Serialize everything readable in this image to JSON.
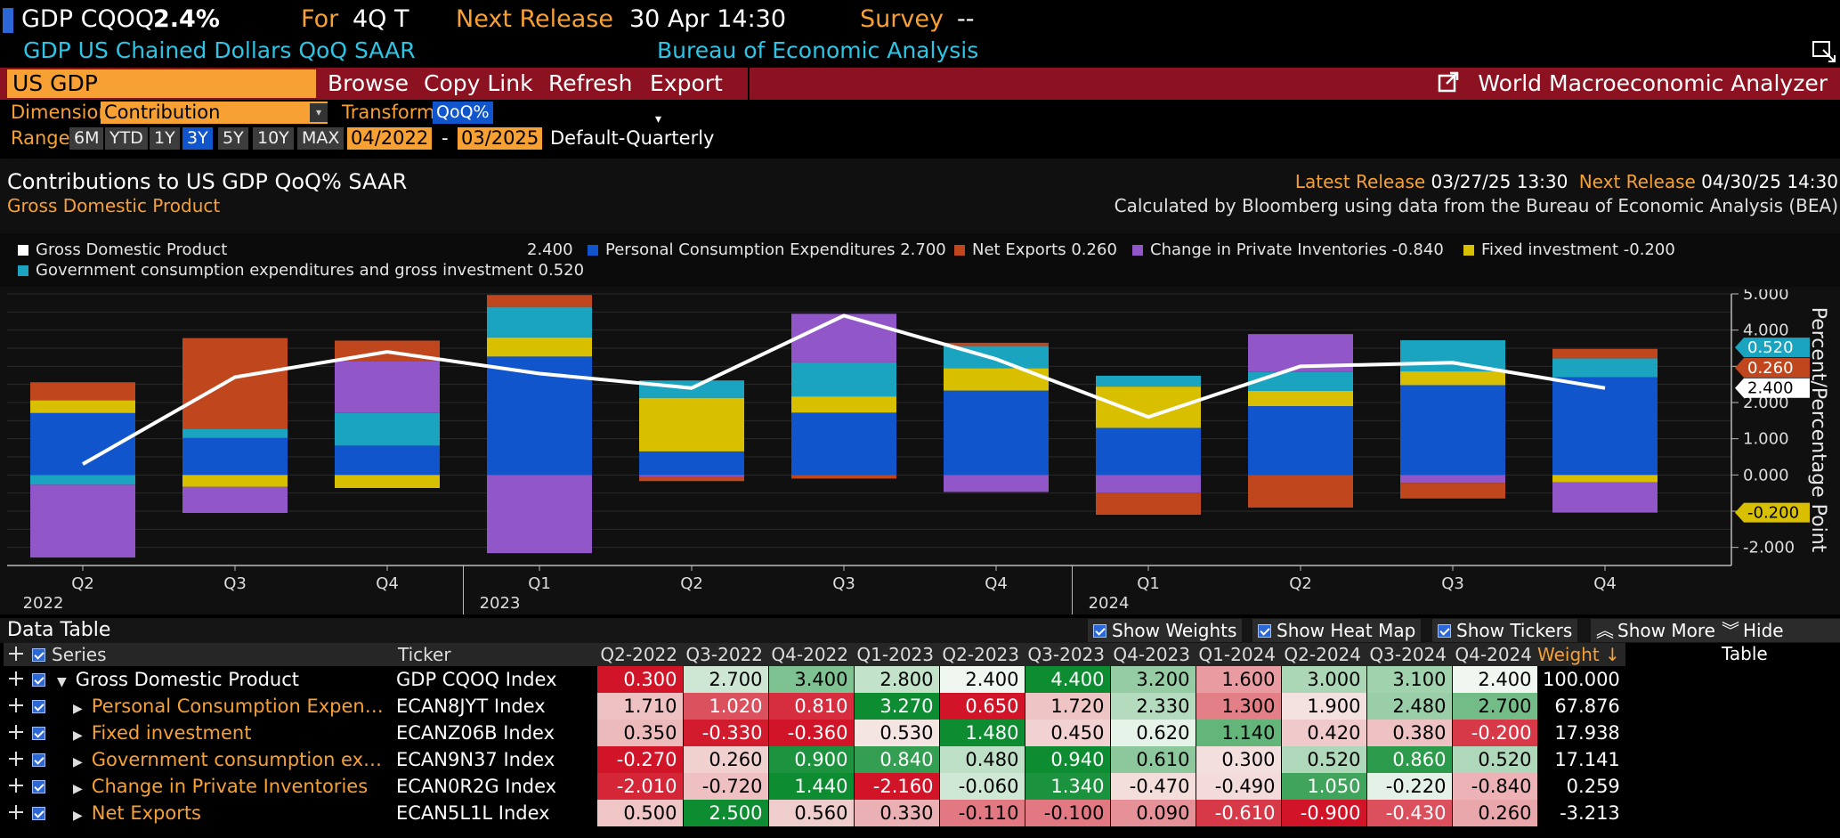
{
  "header": {
    "ticker": "GDP CQOQ",
    "value": "2.4%",
    "for_label": "For",
    "for_value": "4Q T",
    "next_release_label": "Next Release",
    "next_release_value": "30 Apr 14:30",
    "survey_label": "Survey",
    "survey_value": "--",
    "description": "GDP US Chained Dollars QoQ SAAR",
    "source": "Bureau of Economic Analysis"
  },
  "toolbar": {
    "security": "US GDP",
    "browse": "Browse",
    "copy_link": "Copy Link",
    "refresh": "Refresh",
    "export": "Export",
    "app_name": "World Macroeconomic Analyzer"
  },
  "controls": {
    "dimension_label": "Dimension",
    "dimension_value": "Contribution",
    "transform_label": "Transform",
    "transform_value": "QoQ%",
    "range_label": "Range",
    "range_buttons": [
      "6M",
      "YTD",
      "1Y",
      "3Y",
      "5Y",
      "10Y",
      "MAX"
    ],
    "range_selected": "3Y",
    "start_date": "04/2022",
    "range_sep": "-",
    "end_date": "03/2025",
    "frequency": "Default-Quarterly"
  },
  "chart_info": {
    "title": "Contributions to US GDP QoQ% SAAR",
    "subtitle": "Gross Domestic Product",
    "latest_release_label": "Latest Release",
    "latest_release_value": "03/27/25 13:30",
    "next_release_label": "Next Release",
    "next_release_value": "04/30/25 14:30",
    "calc_note": "Calculated by Bloomberg using data from the Bureau of Economic Analysis (BEA)"
  },
  "legend": [
    {
      "label": "Gross Domestic Product",
      "value": "2.400",
      "color": "#ffffff"
    },
    {
      "label": "Personal Consumption Expenditures",
      "value": "2.700",
      "color": "#1155cc"
    },
    {
      "label": "Net Exports",
      "value": "0.260",
      "color": "#c0461e"
    },
    {
      "label": "Change in Private Inventories",
      "value": "-0.840",
      "color": "#9157c9"
    },
    {
      "label": "Fixed investment",
      "value": "-0.200",
      "color": "#d8c000"
    },
    {
      "label": "Government consumption expenditures and gross investment",
      "value": "0.520",
      "color": "#1aa4c0"
    }
  ],
  "chart_data": {
    "type": "bar",
    "stacked": true,
    "categories": [
      "Q2",
      "Q3",
      "Q4",
      "Q1",
      "Q2",
      "Q3",
      "Q4",
      "Q1",
      "Q2",
      "Q3",
      "Q4"
    ],
    "year_labels": [
      "2022",
      "2023",
      "2024"
    ],
    "ylim": [
      -2.5,
      5.0
    ],
    "yticks": [
      "5.000",
      "4.000",
      "3.000",
      "2.000",
      "1.000",
      "0.000",
      "-1.000",
      "-2.000"
    ],
    "ylabel": "Percent/Percentage Point",
    "grid": true,
    "series": [
      {
        "name": "Personal Consumption Expenditures",
        "color": "#1155cc",
        "values": [
          1.71,
          1.02,
          0.81,
          3.27,
          0.65,
          1.72,
          2.33,
          1.3,
          1.9,
          2.48,
          2.7
        ]
      },
      {
        "name": "Fixed investment",
        "color": "#d8c000",
        "values": [
          0.35,
          -0.33,
          -0.36,
          0.53,
          1.48,
          0.45,
          0.62,
          1.14,
          0.42,
          0.38,
          -0.2
        ]
      },
      {
        "name": "Government consumption expenditures and gross investment",
        "color": "#1aa4c0",
        "values": [
          -0.27,
          0.26,
          0.9,
          0.84,
          0.48,
          0.94,
          0.61,
          0.3,
          0.52,
          0.86,
          0.52
        ]
      },
      {
        "name": "Change in Private Inventories",
        "color": "#9157c9",
        "values": [
          -2.01,
          -0.72,
          1.44,
          -2.16,
          -0.06,
          1.34,
          -0.47,
          -0.49,
          1.05,
          -0.22,
          -0.84
        ]
      },
      {
        "name": "Net Exports",
        "color": "#c0461e",
        "values": [
          0.5,
          2.5,
          0.56,
          0.33,
          -0.11,
          -0.1,
          0.09,
          -0.61,
          -0.9,
          -0.43,
          0.26
        ]
      }
    ],
    "line": {
      "name": "Gross Domestic Product",
      "color": "#ffffff",
      "values": [
        0.3,
        2.7,
        3.4,
        2.8,
        2.4,
        4.4,
        3.2,
        1.6,
        3.0,
        3.1,
        2.4
      ]
    },
    "right_labels": [
      {
        "text": "0.520",
        "color": "#1aa4c0",
        "value": 3.52
      },
      {
        "text": "0.260",
        "color": "#c0461e",
        "value": 2.96
      },
      {
        "text": "2.400",
        "color": "#ffffff",
        "value": 2.4
      },
      {
        "text": "-0.200",
        "color": "#d8c000",
        "value": -1.04
      }
    ]
  },
  "data_table": {
    "title": "Data Table",
    "options": [
      "Show Weights",
      "Show Heat Map",
      "Show Tickers"
    ],
    "show_more": "Show More",
    "hide_table": "Hide Table",
    "columns": {
      "series": "Series",
      "ticker": "Ticker",
      "periods": [
        "Q2-2022",
        "Q3-2022",
        "Q4-2022",
        "Q1-2023",
        "Q2-2023",
        "Q3-2023",
        "Q4-2023",
        "Q1-2024",
        "Q2-2024",
        "Q3-2024",
        "Q4-2024"
      ],
      "weight": "Weight ↓"
    },
    "rows": [
      {
        "series": "Gross Domestic Product",
        "ticker": "GDP CQOQ Index",
        "values": [
          "0.300",
          "2.700",
          "3.400",
          "2.800",
          "2.400",
          "4.400",
          "3.200",
          "1.600",
          "3.000",
          "3.100",
          "2.400"
        ],
        "weight": "100.000"
      },
      {
        "series": "Personal Consumption Expen…",
        "ticker": "ECAN8JYT Index",
        "values": [
          "1.710",
          "1.020",
          "0.810",
          "3.270",
          "0.650",
          "1.720",
          "2.330",
          "1.300",
          "1.900",
          "2.480",
          "2.700"
        ],
        "weight": "67.876"
      },
      {
        "series": "Fixed investment",
        "ticker": "ECANZ06B Index",
        "values": [
          "0.350",
          "-0.330",
          "-0.360",
          "0.530",
          "1.480",
          "0.450",
          "0.620",
          "1.140",
          "0.420",
          "0.380",
          "-0.200"
        ],
        "weight": "17.938"
      },
      {
        "series": "Government consumption ex…",
        "ticker": "ECAN9N37 Index",
        "values": [
          "-0.270",
          "0.260",
          "0.900",
          "0.840",
          "0.480",
          "0.940",
          "0.610",
          "0.300",
          "0.520",
          "0.860",
          "0.520"
        ],
        "weight": "17.141"
      },
      {
        "series": "Change in Private Inventories",
        "ticker": "ECAN0R2G Index",
        "values": [
          "-2.010",
          "-0.720",
          "1.440",
          "-2.160",
          "-0.060",
          "1.340",
          "-0.470",
          "-0.490",
          "1.050",
          "-0.220",
          "-0.840"
        ],
        "weight": "0.259"
      },
      {
        "series": "Net Exports",
        "ticker": "ECAN5L1L Index",
        "values": [
          "0.500",
          "2.500",
          "0.560",
          "0.330",
          "-0.110",
          "-0.100",
          "0.090",
          "-0.610",
          "-0.900",
          "-0.430",
          "0.260"
        ],
        "weight": "-3.213"
      }
    ]
  }
}
